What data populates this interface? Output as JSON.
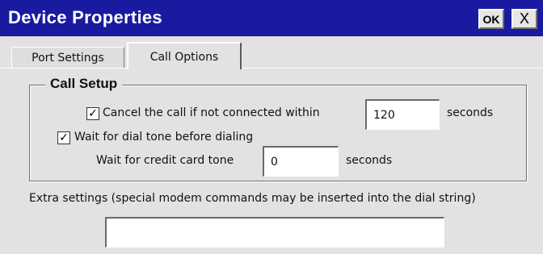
{
  "window": {
    "title": "Device Properties",
    "ok_label": "OK",
    "close_label": "X"
  },
  "tabs": [
    {
      "label": "Port Settings",
      "selected": false
    },
    {
      "label": "Call Options",
      "selected": true
    }
  ],
  "call_setup": {
    "title": "Call Setup",
    "cancel_call": {
      "checked": true,
      "label": "Cancel the call if not connected within",
      "value": "120",
      "unit": "seconds"
    },
    "wait_dial_tone": {
      "checked": true,
      "label": "Wait for dial tone before dialing"
    },
    "credit_card_tone": {
      "label": "Wait for credit card tone",
      "value": "0",
      "unit": "seconds"
    }
  },
  "extra_settings": {
    "label": "Extra settings (special modem commands may be inserted into the dial string)",
    "value": ""
  },
  "glyphs": {
    "check": "✓"
  },
  "colors": {
    "titlebar": "#1a1aa0",
    "background": "#e2e2e2"
  }
}
